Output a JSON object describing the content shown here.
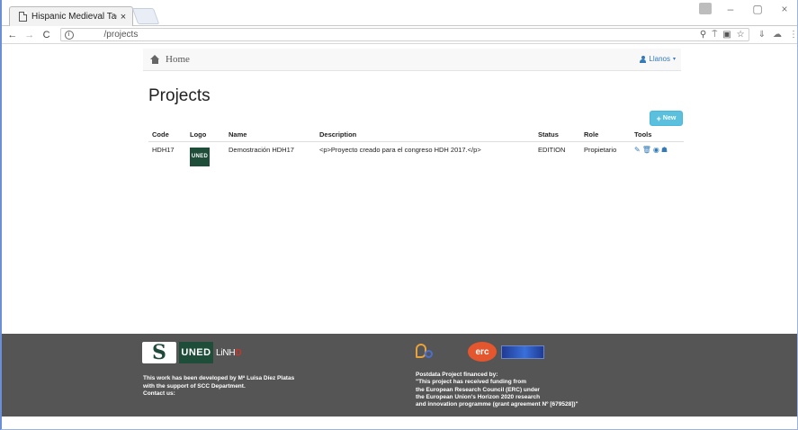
{
  "browser": {
    "tab_title": "Hispanic Medieval Tagge",
    "tab_close": "×",
    "window_controls": [
      "–",
      "▢",
      "×"
    ],
    "url": "/projects",
    "nav_icons": [
      "back-icon",
      "forward-icon",
      "reload-icon"
    ],
    "omnibox_icons": [
      "zoom-icon",
      "pin-icon",
      "translate-icon",
      "star-icon"
    ],
    "extension_icons": [
      "download-icon",
      "cloud-icon",
      "menu-icon"
    ]
  },
  "navbar": {
    "home_label": "Home",
    "user_label": "Llanos"
  },
  "main": {
    "title": "Projects",
    "new_button_label": "New",
    "table": {
      "headers": [
        "Code",
        "Logo",
        "Name",
        "Description",
        "Status",
        "Role",
        "Tools"
      ],
      "rows": [
        {
          "code": "HDH17",
          "logo_text": "UNED",
          "name": "Demostración HDH17",
          "description": "<p>Proyecto creado para el congreso HDH 2017.</p>",
          "status": "EDITION",
          "role": "Propietario",
          "tools": [
            "edit-icon",
            "trash-icon",
            "eye-icon",
            "users-icon"
          ]
        }
      ]
    }
  },
  "footer": {
    "left_logos": {
      "s_logo": "S",
      "uned": "UNED",
      "linhd": "LiNHD"
    },
    "right_logos": {
      "erc": "erc"
    },
    "left_text": [
      "This work has been developed by Mª Luisa Díez Platas",
      "with the support of SCC Department.",
      "Contact us:"
    ],
    "right_text": [
      "Postdata Project financed by:",
      "\"This project has received funding from",
      "the European Research Council (ERC) under",
      "the European Union's Horizon 2020 research",
      "and innovation programme (grant agreement Nº [679528])\""
    ]
  },
  "colors": {
    "accent": "#337ab7",
    "new_button": "#5bc0de",
    "footer_bg": "#555555",
    "uned_green": "#1e4d3a"
  }
}
